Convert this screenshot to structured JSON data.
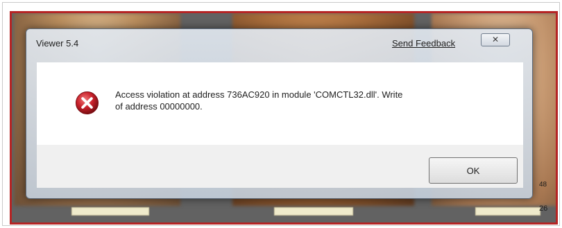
{
  "dialog": {
    "title": "Viewer 5.4",
    "feedback_link": "Send Feedback",
    "close_glyph": "✕",
    "message_line1": "Access violation at address 736AC920 in module 'COMCTL32.dll'. Write",
    "message_line2": "of address 00000000.",
    "ok_label": "OK",
    "icon": "error-icon"
  },
  "background": {
    "corner_number": "48",
    "corner_number_2": "26"
  },
  "colors": {
    "viewer_border": "#b52424",
    "error_icon": "#c8202a"
  }
}
